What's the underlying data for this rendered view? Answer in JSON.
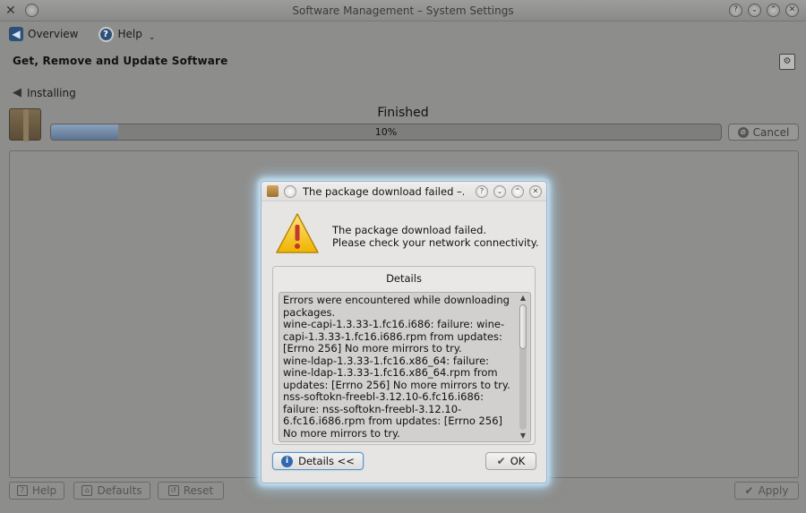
{
  "window": {
    "title": "Software Management – System Settings",
    "controls": [
      "?",
      "⌄",
      "⌃",
      "✕"
    ]
  },
  "toolbar": {
    "overview_label": "Overview",
    "help_label": "Help"
  },
  "page": {
    "title": "Get, Remove and Update Software",
    "back_label": "Installing",
    "status": "Finished",
    "progress_text": "10%",
    "progress_value": 0.1,
    "cancel_label": "Cancel"
  },
  "bottom": {
    "help_label": "Help",
    "defaults_label": "Defaults",
    "reset_label": "Reset",
    "apply_label": "Apply"
  },
  "dialog": {
    "title": "The package download failed –...",
    "message_line1": "The package download failed.",
    "message_line2": "Please check your network connectivity.",
    "details_label": "Details",
    "details_text": "Errors were encountered while downloading packages.\nwine-capi-1.3.33-1.fc16.i686: failure: wine-capi-1.3.33-1.fc16.i686.rpm from updates: [Errno 256] No more mirrors to try.\nwine-ldap-1.3.33-1.fc16.x86_64: failure: wine-ldap-1.3.33-1.fc16.x86_64.rpm from updates: [Errno 256] No more mirrors to try.\nnss-softokn-freebl-3.12.10-6.fc16.i686: failure: nss-softokn-freebl-3.12.10-6.fc16.i686.rpm from updates: [Errno 256] No more mirrors to try.",
    "details_button_label": "Details <<",
    "ok_label": "OK"
  },
  "colors": {
    "accent": "#2f68ad",
    "glow": "#c6e3f6",
    "warning": "#f2c12e"
  }
}
